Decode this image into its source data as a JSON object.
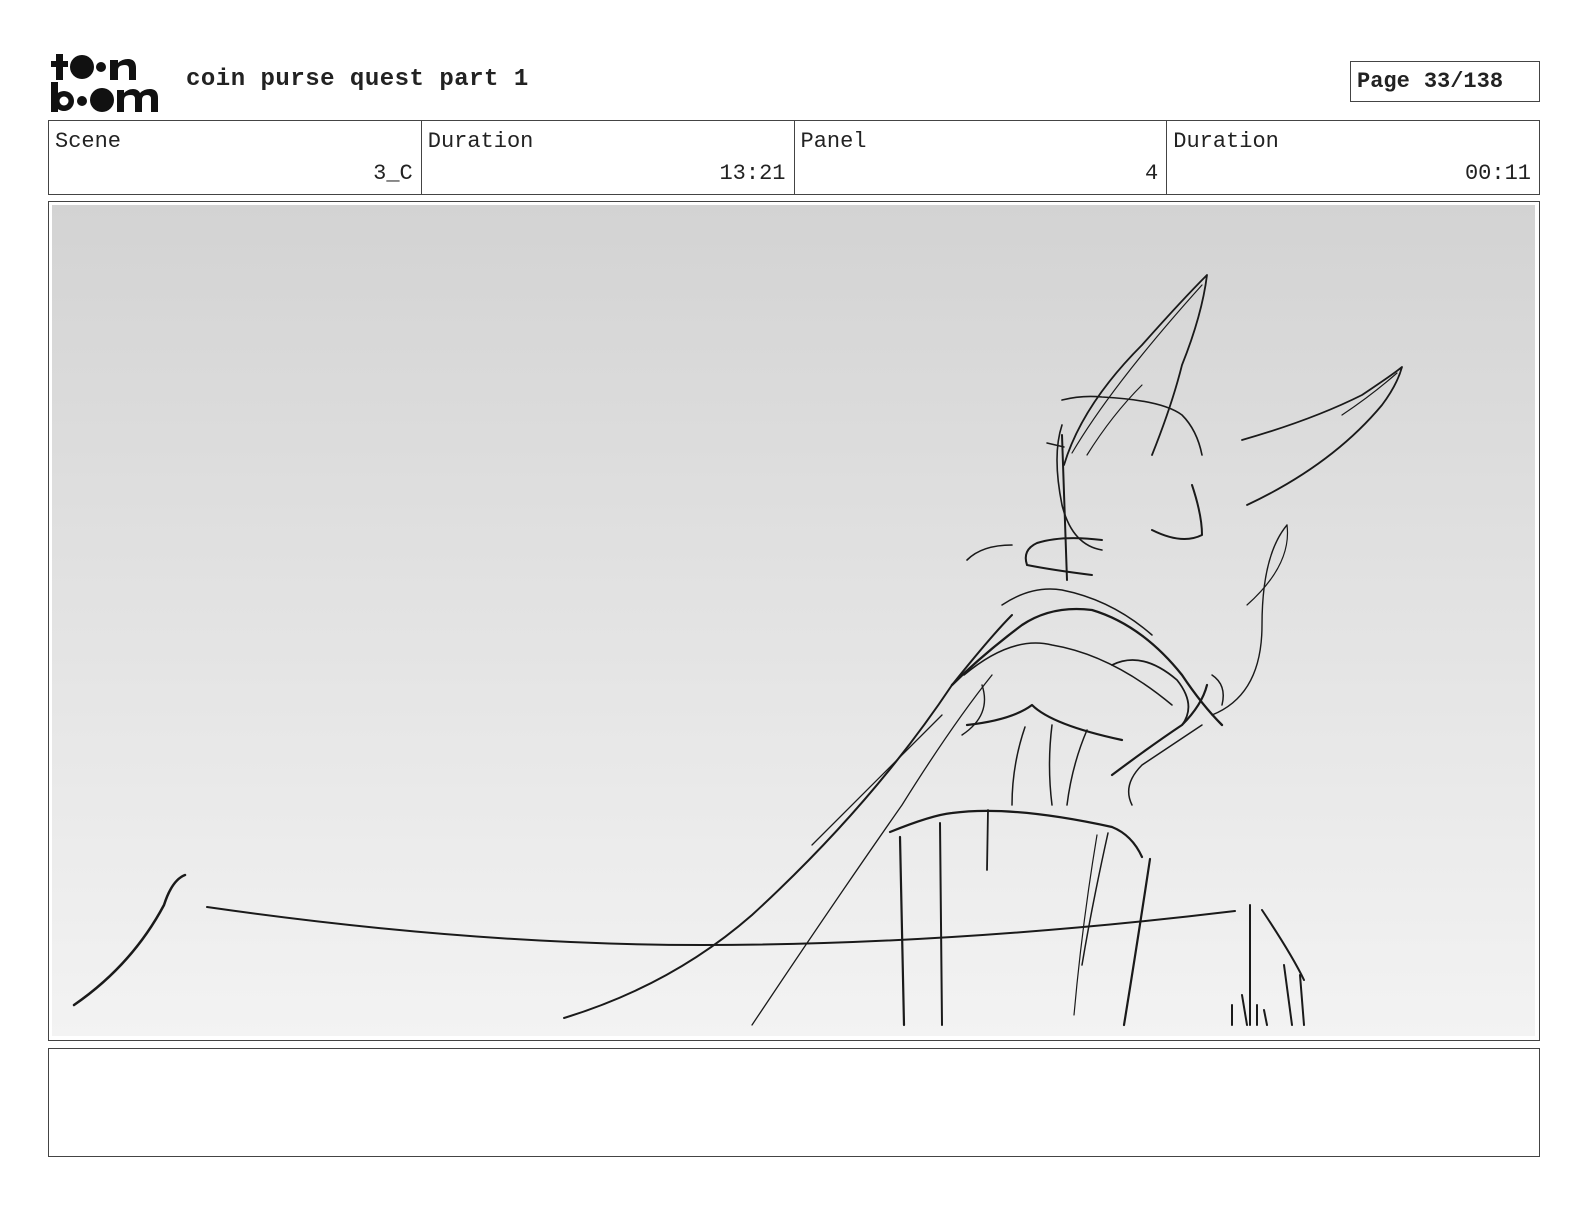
{
  "header": {
    "logo_text": "toon boom",
    "project_title": "coin purse quest part 1",
    "page_label": "Page",
    "page_value": "33/138"
  },
  "info_bar": {
    "scene_label": "Scene",
    "scene_value": "3_C",
    "scene_duration_label": "Duration",
    "scene_duration_value": "13:21",
    "panel_label": "Panel",
    "panel_value": "4",
    "panel_duration_label": "Duration",
    "panel_duration_value": "00:11"
  },
  "panel": {
    "image_subject": "rough-sketch-character-on-post",
    "background_gradient": [
      "#d3d3d3",
      "#f3f3f3"
    ]
  },
  "notes": {
    "text": ""
  }
}
